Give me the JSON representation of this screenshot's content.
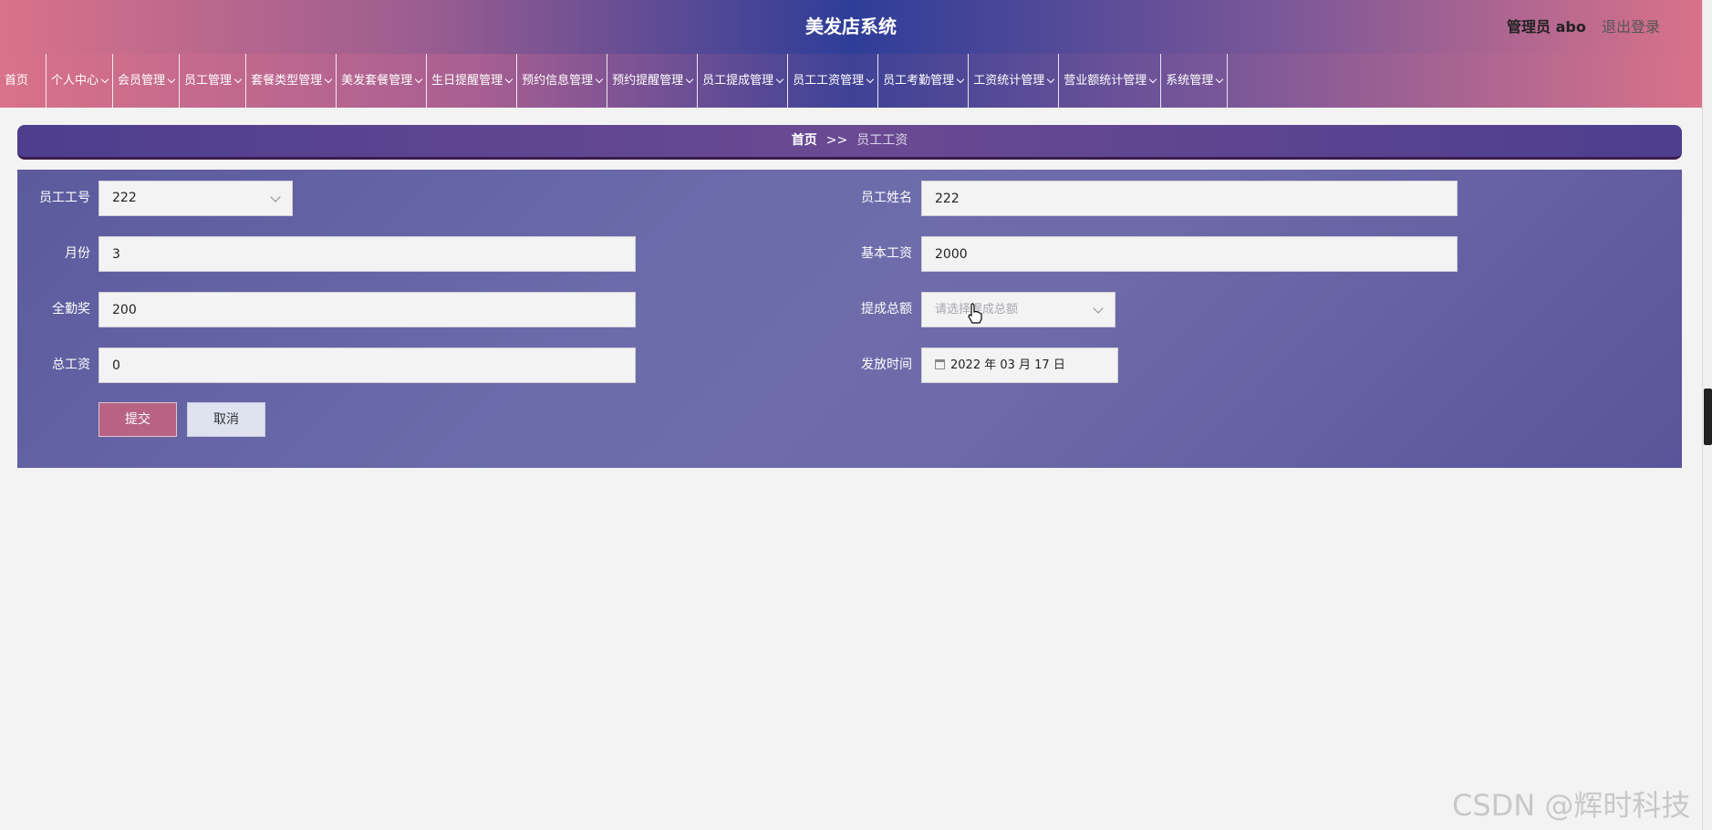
{
  "header": {
    "title": "美发店系统",
    "user": "管理员 abo",
    "logout": "退出登录"
  },
  "nav": {
    "items": [
      {
        "label": "首页",
        "dropdown": false
      },
      {
        "label": "个人中心",
        "dropdown": true
      },
      {
        "label": "会员管理",
        "dropdown": true
      },
      {
        "label": "员工管理",
        "dropdown": true
      },
      {
        "label": "套餐类型管理",
        "dropdown": true
      },
      {
        "label": "美发套餐管理",
        "dropdown": true
      },
      {
        "label": "生日提醒管理",
        "dropdown": true
      },
      {
        "label": "预约信息管理",
        "dropdown": true
      },
      {
        "label": "预约提醒管理",
        "dropdown": true
      },
      {
        "label": "员工提成管理",
        "dropdown": true
      },
      {
        "label": "员工工资管理",
        "dropdown": true
      },
      {
        "label": "员工考勤管理",
        "dropdown": true
      },
      {
        "label": "工资统计管理",
        "dropdown": true
      },
      {
        "label": "营业额统计管理",
        "dropdown": true
      },
      {
        "label": "系统管理",
        "dropdown": true
      }
    ]
  },
  "breadcrumb": {
    "home": "首页",
    "separator": ">>",
    "current": "员工工资"
  },
  "form": {
    "employee_id": {
      "label": "员工工号",
      "value": "222"
    },
    "employee_name": {
      "label": "员工姓名",
      "value": "222"
    },
    "month": {
      "label": "月份",
      "value": "3"
    },
    "base_salary": {
      "label": "基本工资",
      "value": "2000"
    },
    "attendance_bonus": {
      "label": "全勤奖",
      "value": "200"
    },
    "commission_total": {
      "label": "提成总额",
      "placeholder": "请选择提成总额"
    },
    "total_salary": {
      "label": "总工资",
      "value": "0"
    },
    "pay_date": {
      "label": "发放时间",
      "value": "2022 年 03 月 17 日"
    },
    "submit": "提交",
    "cancel": "取消"
  },
  "watermark": "CSDN @辉时科技",
  "colors": {
    "submit_button": "#b86384",
    "panel": "#6d6cab",
    "breadcrumb": "#4d3e8e"
  }
}
